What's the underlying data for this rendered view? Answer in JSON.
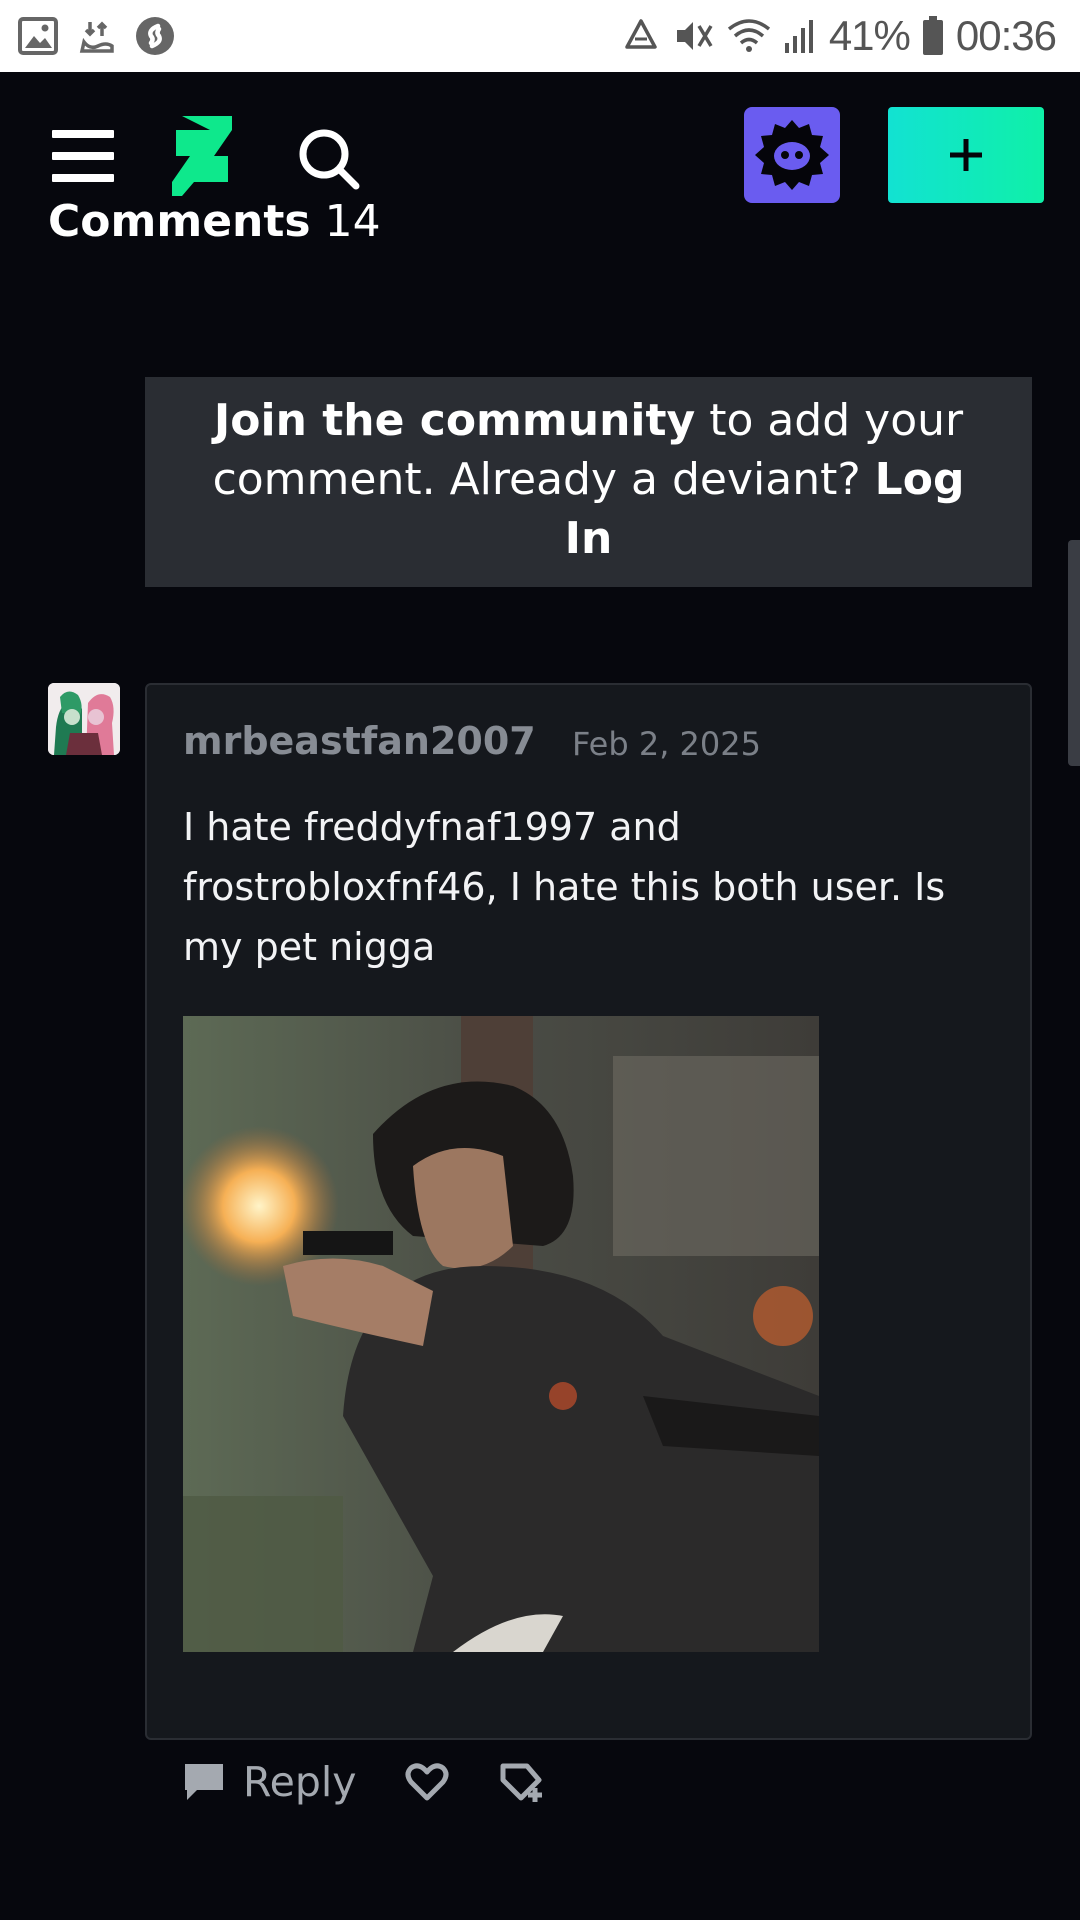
{
  "status_bar": {
    "battery_percent": "41%",
    "time": "00:36",
    "left_icons": [
      "image-icon",
      "pie-dance-icon",
      "shazam-icon"
    ],
    "right_icons": [
      "recycle-icon",
      "mute-icon",
      "wifi-icon",
      "signal-icon",
      "battery-icon"
    ]
  },
  "nav": {
    "icons": [
      "hamburger-menu-icon",
      "deviantart-logo-icon",
      "search-icon",
      "avatar-icon",
      "plus-icon"
    ],
    "colors": {
      "avatar_bg": "#6a5cf0",
      "create_gradient_start": "#12e2d2",
      "create_gradient_end": "#0ff0a8",
      "logo": "#0ee88c"
    }
  },
  "comments": {
    "title": "Comments",
    "count": "14"
  },
  "join_prompt": {
    "bold_lead": "Join the community",
    "middle": " to add your comment. Already a deviant? ",
    "login": "Log In"
  },
  "comment": {
    "author": "mrbeastfan2007",
    "date": "Feb 2, 2025",
    "text": "I hate freddyfnaf1997 and frostrobloxfnf46, I hate this both user. Is my pet nigga",
    "image_description_icon": "attached-image"
  },
  "actions": {
    "reply_label": "Reply",
    "icons": [
      "reply-bubble-icon",
      "heart-icon",
      "collect-tag-icon"
    ]
  }
}
